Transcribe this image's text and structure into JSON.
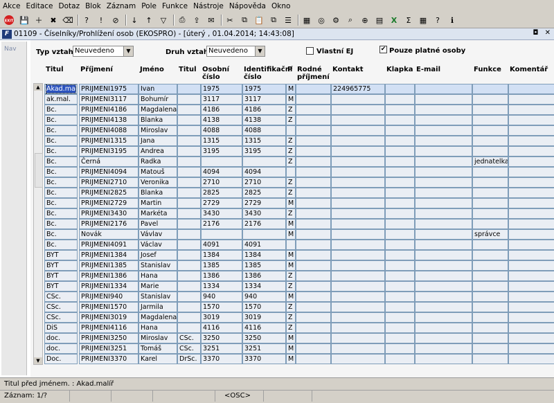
{
  "menu": [
    "Akce",
    "Editace",
    "Dotaz",
    "Blok",
    "Záznam",
    "Pole",
    "Funkce",
    "Nástroje",
    "Nápověda",
    "Okno"
  ],
  "toolbar": {
    "exit_label": "EXIT",
    "icons": [
      "save-icon",
      "new-record-icon",
      "delete-record-icon",
      "clear-icon",
      "query-icon",
      "execute-query-icon",
      "cancel-query-icon",
      "sort-asc-icon",
      "sort-desc-icon",
      "filter-icon",
      "print-icon",
      "export-icon",
      "mail-icon",
      "cut-icon",
      "copy-icon",
      "paste-icon",
      "duplicate-icon",
      "properties-icon",
      "calculator-icon",
      "web-icon",
      "settings-icon",
      "lookup-icon",
      "zoom-icon",
      "calendar-icon",
      "excel-icon",
      "sum-icon",
      "table-icon",
      "help-icon",
      "info-icon"
    ]
  },
  "window": {
    "logo": "F",
    "title": "01109 - Číselníky/Prohlížení osob (EKOSPRO) - [úterý , 01.04.2014; 14:43:08]",
    "restore_glyph": "◘",
    "close_glyph": "✕"
  },
  "nav": {
    "label": "Nav"
  },
  "filters": {
    "typ_vztahu_label": "Typ vztahu",
    "typ_vztahu_value": "Neuvedeno",
    "druh_vztahu_label": "Druh vztahu",
    "druh_vztahu_value": "Neuvedeno",
    "vlastni_ej_label": "Vlastní EJ",
    "vlastni_ej_checked": false,
    "platne_label": "Pouze platné osoby",
    "platne_checked": true
  },
  "table": {
    "columns": [
      {
        "l1": "",
        "l2": "Titul"
      },
      {
        "l1": "",
        "l2": "Příjmení"
      },
      {
        "l1": "",
        "l2": "Jméno"
      },
      {
        "l1": "",
        "l2": "Titul"
      },
      {
        "l1": "Osobní",
        "l2": "číslo"
      },
      {
        "l1": "Identifikační",
        "l2": "číslo"
      },
      {
        "l1": "",
        "l2": "P"
      },
      {
        "l1": "Rodné",
        "l2": "příjmení"
      },
      {
        "l1": "",
        "l2": "Kontakt"
      },
      {
        "l1": "",
        "l2": "Klapka"
      },
      {
        "l1": "",
        "l2": "E-mail"
      },
      {
        "l1": "",
        "l2": "Funkce"
      },
      {
        "l1": "",
        "l2": "Komentář"
      }
    ],
    "rows": [
      [
        "Akad.ma",
        "PRIJMENI1975",
        "Ivan",
        "",
        "1975",
        "1975",
        "M",
        "",
        "224965775",
        "",
        "",
        "",
        ""
      ],
      [
        "ak.mal.",
        "PRIJMENI3117",
        "Bohumír",
        "",
        "3117",
        "3117",
        "M",
        "",
        "",
        "",
        "",
        "",
        ""
      ],
      [
        "Bc.",
        "PRIJMENI4186",
        "Magdalena",
        "",
        "4186",
        "4186",
        "Z",
        "",
        "",
        "",
        "",
        "",
        ""
      ],
      [
        "Bc.",
        "PRIJMENI4138",
        "Blanka",
        "",
        "4138",
        "4138",
        "Z",
        "",
        "",
        "",
        "",
        "",
        ""
      ],
      [
        "Bc.",
        "PRIJMENI4088",
        "Miroslav",
        "",
        "4088",
        "4088",
        "",
        "",
        "",
        "",
        "",
        "",
        ""
      ],
      [
        "Bc.",
        "PRIJMENI1315",
        "Jana",
        "",
        "1315",
        "1315",
        "Z",
        "",
        "",
        "",
        "",
        "",
        ""
      ],
      [
        "Bc.",
        "PRIJMENI3195",
        "Andrea",
        "",
        "3195",
        "3195",
        "Z",
        "",
        "",
        "",
        "",
        "",
        ""
      ],
      [
        "Bc.",
        "Černá",
        "Radka",
        "",
        "",
        "",
        "Z",
        "",
        "",
        "",
        "",
        "jednatelka",
        ""
      ],
      [
        "Bc.",
        "PRIJMENI4094",
        "Matouš",
        "",
        "4094",
        "4094",
        "",
        "",
        "",
        "",
        "",
        "",
        ""
      ],
      [
        "Bc.",
        "PRIJMENI2710",
        "Veronika",
        "",
        "2710",
        "2710",
        "Z",
        "",
        "",
        "",
        "",
        "",
        ""
      ],
      [
        "Bc.",
        "PRIJMENI2825",
        "Blanka",
        "",
        "2825",
        "2825",
        "Z",
        "",
        "",
        "",
        "",
        "",
        ""
      ],
      [
        "Bc.",
        "PRIJMENI2729",
        "Martin",
        "",
        "2729",
        "2729",
        "M",
        "",
        "",
        "",
        "",
        "",
        ""
      ],
      [
        "Bc.",
        "PRIJMENI3430",
        "Markéta",
        "",
        "3430",
        "3430",
        "Z",
        "",
        "",
        "",
        "",
        "",
        ""
      ],
      [
        "Bc.",
        "PRIJMENI2176",
        "Pavel",
        "",
        "2176",
        "2176",
        "M",
        "",
        "",
        "",
        "",
        "",
        ""
      ],
      [
        "Bc.",
        "Novák",
        "Vávlav",
        "",
        "",
        "",
        "M",
        "",
        "",
        "",
        "",
        "správce",
        ""
      ],
      [
        "Bc.",
        "PRIJMENI4091",
        "Václav",
        "",
        "4091",
        "4091",
        "",
        "",
        "",
        "",
        "",
        "",
        ""
      ],
      [
        "BYT",
        "PRIJMENI1384",
        "Josef",
        "",
        "1384",
        "1384",
        "M",
        "",
        "",
        "",
        "",
        "",
        ""
      ],
      [
        "BYT",
        "PRIJMENI1385",
        "Stanislav",
        "",
        "1385",
        "1385",
        "M",
        "",
        "",
        "",
        "",
        "",
        ""
      ],
      [
        "BYT",
        "PRIJMENI1386",
        "Hana",
        "",
        "1386",
        "1386",
        "Z",
        "",
        "",
        "",
        "",
        "",
        ""
      ],
      [
        "BYT",
        "PRIJMENI1334",
        "Marie",
        "",
        "1334",
        "1334",
        "Z",
        "",
        "",
        "",
        "",
        "",
        ""
      ],
      [
        "CSc.",
        "PRIJMENI940",
        "Stanislav",
        "",
        "940",
        "940",
        "M",
        "",
        "",
        "",
        "",
        "",
        ""
      ],
      [
        "CSc.",
        "PRIJMENI1570",
        "Jarmila",
        "",
        "1570",
        "1570",
        "Z",
        "",
        "",
        "",
        "",
        "",
        ""
      ],
      [
        "CSc.",
        "PRIJMENI3019",
        "Magdalena",
        "",
        "3019",
        "3019",
        "Z",
        "",
        "",
        "",
        "",
        "",
        ""
      ],
      [
        "DiS",
        "PRIJMENI4116",
        "Hana",
        "",
        "4116",
        "4116",
        "Z",
        "",
        "",
        "",
        "",
        "",
        ""
      ],
      [
        "doc.",
        "PRIJMENI3250",
        "Miroslav",
        "CSc.",
        "3250",
        "3250",
        "M",
        "",
        "",
        "",
        "",
        "",
        ""
      ],
      [
        "doc.",
        "PRIJMENI3251",
        "Tomáš",
        "CSc.",
        "3251",
        "3251",
        "M",
        "",
        "",
        "",
        "",
        "",
        ""
      ],
      [
        "Doc.",
        "PRIJMENI3370",
        "Karel",
        "DrSc.",
        "3370",
        "3370",
        "M",
        "",
        "",
        "",
        "",
        "",
        ""
      ]
    ]
  },
  "status": {
    "hint": "Titul před jménem. : Akad.malíř",
    "record": "Záznam: 1/?",
    "mode": "<OSC>"
  }
}
